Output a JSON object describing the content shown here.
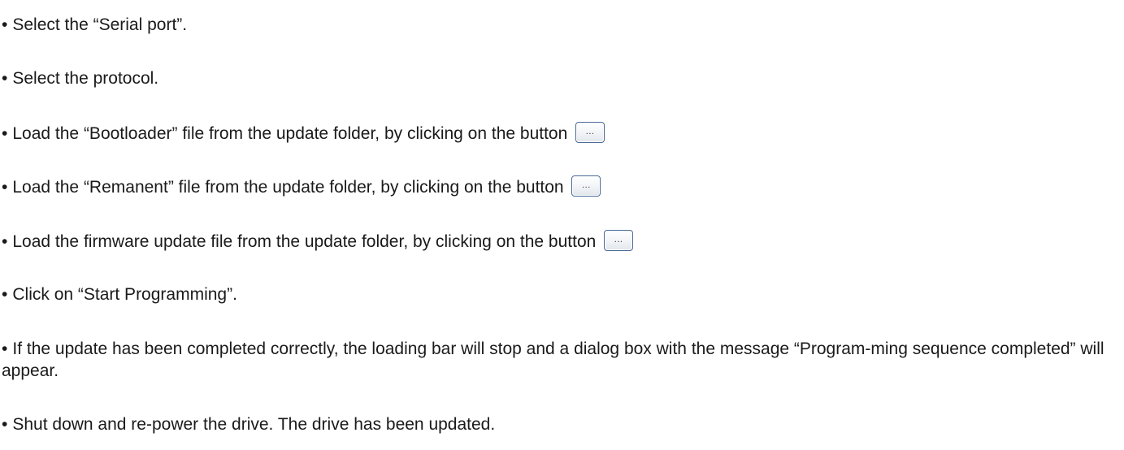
{
  "bullet_char": "•",
  "steps": [
    {
      "text": "Select the “Serial port”."
    },
    {
      "text": "Select the protocol."
    },
    {
      "text": "Load the “Bootloader” file from the update folder, by clicking on the button",
      "button_label": "..."
    },
    {
      "text": "Load the “Remanent” file from the update folder, by clicking on the button",
      "button_label": "..."
    },
    {
      "text": "Load the firmware update file from the update folder, by clicking on the button",
      "button_label": "..."
    },
    {
      "text": "Click on “Start Programming”."
    },
    {
      "text": "If the update has been completed correctly, the loading bar will stop and a dialog box with the message “Program-ming sequence completed” will appear."
    },
    {
      "text": "Shut down and re-power the drive. The drive has been updated."
    }
  ]
}
